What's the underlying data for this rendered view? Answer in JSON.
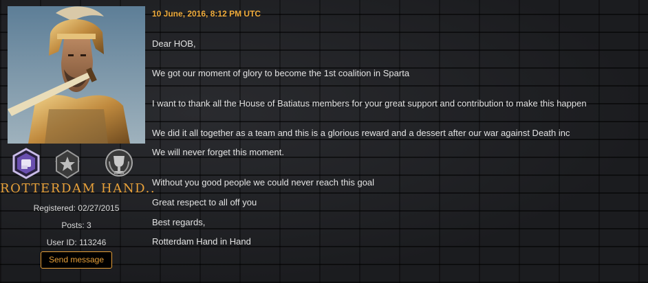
{
  "profile": {
    "username": "ROTTERDAM HAND..",
    "registered": "Registered: 02/27/2015",
    "posts": "Posts: 3",
    "user_id": "User ID: 113246",
    "send_button_label": "Send message",
    "badges": [
      "fist-rank-badge",
      "star-wings-badge",
      "trophy-laurel-badge"
    ]
  },
  "post": {
    "timestamp": "10 June, 2016, 8:12 PM UTC",
    "lines": [
      "Dear HOB,",
      "We got our moment of glory to become the 1st coalition in Sparta",
      "I want to thank all the House of Batiatus members for your great support and contribution to make this happen",
      "We did it all together as a team and this is a glorious reward and a dessert after our war against Death inc",
      "We will never forget this moment.",
      "Without you good people we could never reach this goal",
      "Great respect to all off you",
      "Best regards,",
      "Rotterdam Hand in Hand"
    ]
  },
  "colors": {
    "accent": "#e8a13a",
    "timestamp": "#f0ab3a",
    "body_text": "#e3e3e3",
    "meta_text": "#d8d8d8"
  }
}
